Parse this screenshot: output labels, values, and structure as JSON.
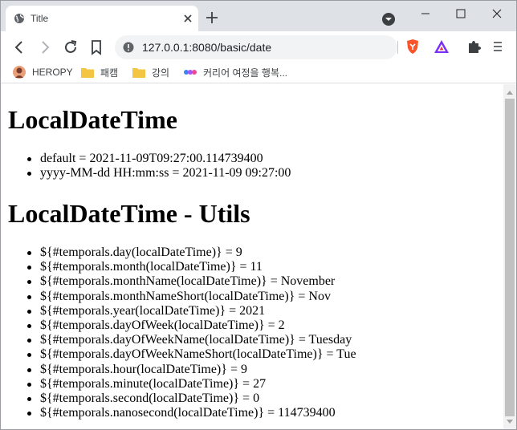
{
  "tab": {
    "title": "Title"
  },
  "address_bar": {
    "url": "127.0.0.1:8080/basic/date"
  },
  "bookmarks": [
    {
      "label": "HEROPY",
      "icon": "avatar-icon"
    },
    {
      "label": "패캠",
      "icon": "folder-icon"
    },
    {
      "label": "강의",
      "icon": "folder-icon"
    },
    {
      "label": "커리어 여정을 행복...",
      "icon": "app-icon"
    }
  ],
  "sections": [
    {
      "heading": "LocalDateTime",
      "items": [
        "default = 2021-11-09T09:27:00.114739400",
        "yyyy-MM-dd HH:mm:ss = 2021-11-09 09:27:00"
      ]
    },
    {
      "heading": "LocalDateTime - Utils",
      "items": [
        "${#temporals.day(localDateTime)} = 9",
        "${#temporals.month(localDateTime)} = 11",
        "${#temporals.monthName(localDateTime)} = November",
        "${#temporals.monthNameShort(localDateTime)} = Nov",
        "${#temporals.year(localDateTime)} = 2021",
        "${#temporals.dayOfWeek(localDateTime)} = 2",
        "${#temporals.dayOfWeekName(localDateTime)} = Tuesday",
        "${#temporals.dayOfWeekNameShort(localDateTime)} = Tue",
        "${#temporals.hour(localDateTime)} = 9",
        "${#temporals.minute(localDateTime)} = 27",
        "${#temporals.second(localDateTime)} = 0",
        "${#temporals.nanosecond(localDateTime)} = 114739400"
      ]
    }
  ],
  "colors": {
    "tabstrip_bg": "#dee1e6",
    "omnibox_bg": "#f1f3f4",
    "brave_orange": "#fb542b",
    "folder_yellow": "#f4c542"
  }
}
